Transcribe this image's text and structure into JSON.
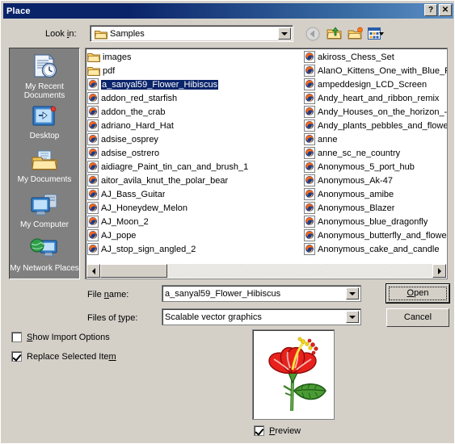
{
  "window": {
    "title": "Place",
    "help_button": "?",
    "close_button": "✕"
  },
  "toolbar": {
    "lookin_label": "Look in:",
    "lookin_value": "Samples",
    "back_icon": "back-arrow-icon",
    "up_icon": "up-one-level-icon",
    "new_folder_icon": "new-folder-icon",
    "views_icon": "views-menu-icon"
  },
  "places": {
    "items": [
      {
        "label": "My Recent Documents",
        "icon": "recent-documents-icon"
      },
      {
        "label": "Desktop",
        "icon": "desktop-icon"
      },
      {
        "label": "My Documents",
        "icon": "my-documents-icon"
      },
      {
        "label": "My Computer",
        "icon": "my-computer-icon"
      },
      {
        "label": "My Network Places",
        "icon": "network-places-icon"
      }
    ]
  },
  "file_list": {
    "column1": [
      {
        "name": "images",
        "type": "folder"
      },
      {
        "name": "pdf",
        "type": "folder"
      },
      {
        "name": "a_sanyal59_Flower_Hibiscus",
        "type": "svg",
        "selected": true
      },
      {
        "name": "addon_red_starfish",
        "type": "svg"
      },
      {
        "name": "addon_the_crab",
        "type": "svg"
      },
      {
        "name": "adriano_Hard_Hat",
        "type": "svg"
      },
      {
        "name": "adsise_osprey",
        "type": "svg"
      },
      {
        "name": "adsise_ostrero",
        "type": "svg"
      },
      {
        "name": "aidiagre_Paint_tin_can_and_brush_1",
        "type": "svg"
      },
      {
        "name": "aitor_avila_knut_the_polar_bear",
        "type": "svg"
      },
      {
        "name": "AJ_Bass_Guitar",
        "type": "svg"
      },
      {
        "name": "AJ_Honeydew_Melon",
        "type": "svg"
      },
      {
        "name": "AJ_Moon_2",
        "type": "svg"
      },
      {
        "name": "AJ_pope",
        "type": "svg"
      },
      {
        "name": "AJ_stop_sign_angled_2",
        "type": "svg"
      }
    ],
    "column2": [
      {
        "name": "akiross_Chess_Set",
        "type": "svg"
      },
      {
        "name": "AlanO_Kittens_One_with_Blue_Ri",
        "type": "svg"
      },
      {
        "name": "ampeddesign_LCD_Screen",
        "type": "svg"
      },
      {
        "name": "Andy_heart_and_ribbon_remix",
        "type": "svg"
      },
      {
        "name": "Andy_Houses_on_the_horizon_-_",
        "type": "svg"
      },
      {
        "name": "Andy_plants_pebbles_and_flower",
        "type": "svg"
      },
      {
        "name": "anne",
        "type": "svg"
      },
      {
        "name": "anne_sc_ne_country",
        "type": "svg"
      },
      {
        "name": "Anonymous_5_port_hub",
        "type": "svg"
      },
      {
        "name": "Anonymous_Ak-47",
        "type": "svg"
      },
      {
        "name": "Anonymous_amibe",
        "type": "svg"
      },
      {
        "name": "Anonymous_Blazer",
        "type": "svg"
      },
      {
        "name": "Anonymous_blue_dragonfly",
        "type": "svg"
      },
      {
        "name": "Anonymous_butterfly_and_flowe",
        "type": "svg"
      },
      {
        "name": "Anonymous_cake_and_candle",
        "type": "svg"
      }
    ]
  },
  "fields": {
    "filename_label": "File name:",
    "filename_value": "a_sanyal59_Flower_Hibiscus",
    "filetype_label": "Files of type:",
    "filetype_value": "Scalable vector graphics"
  },
  "buttons": {
    "open": "Open",
    "cancel": "Cancel"
  },
  "options": {
    "show_import_options": {
      "label": "Show Import Options",
      "checked": false
    },
    "replace_selected_item": {
      "label": "Replace Selected Item",
      "checked": true
    },
    "preview": {
      "label": "Preview",
      "checked": true
    }
  },
  "preview": {
    "image_name": "hibiscus-flower-preview",
    "petal_color": "#e8211c",
    "leaf_color": "#4a9b34",
    "stamen_color": "#f2d31a"
  },
  "colors": {
    "dialog_face": "#d4d0c8",
    "titlebar_start": "#0a246a",
    "titlebar_end": "#5c8fc4",
    "places_bg": "#808080",
    "selection": "#0a246a"
  }
}
